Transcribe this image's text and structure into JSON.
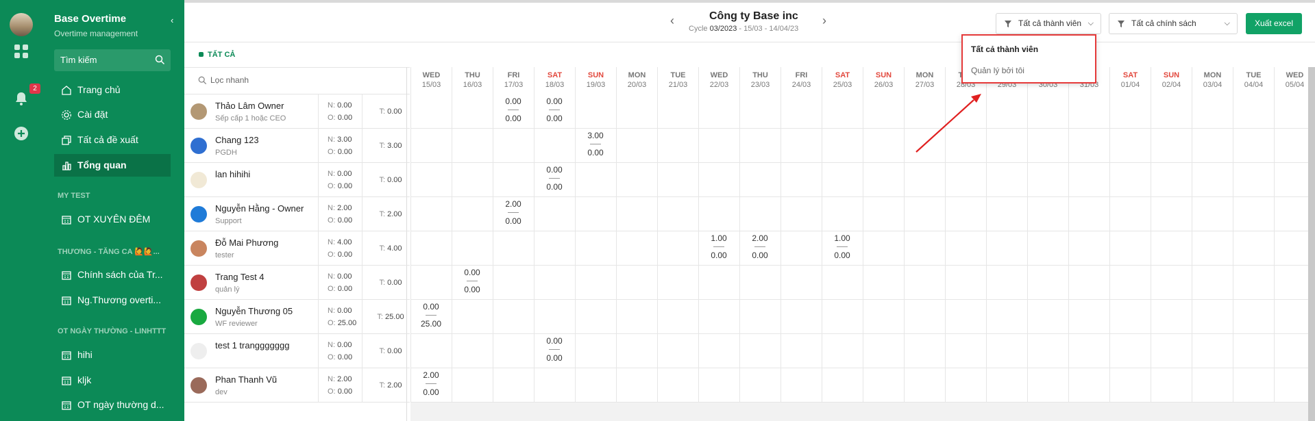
{
  "app": {
    "title": "Base Overtime",
    "subtitle": "Overtime management",
    "notif_count": "2"
  },
  "sidebar": {
    "search_label": "Tìm kiếm",
    "items": [
      {
        "label": "Trang chủ",
        "icon": "home-icon"
      },
      {
        "label": "Cài đặt",
        "icon": "gear-icon"
      },
      {
        "label": "Tất cả đề xuất",
        "icon": "copy-icon"
      },
      {
        "label": "Tổng quan",
        "icon": "chart-icon"
      }
    ],
    "groups": [
      {
        "title": "MY TEST",
        "items": [
          "OT XUYÊN ĐÊM"
        ]
      },
      {
        "title": "THƯƠNG - TĂNG CA 🙋🙋...",
        "items": [
          "Chính sách của Tr...",
          "Ng.Thương overti..."
        ]
      },
      {
        "title": "OT NGÀY THƯỜNG - LINHTTT",
        "items": [
          "hihi",
          "kljk",
          "OT ngày thường d..."
        ]
      }
    ]
  },
  "header": {
    "company": "Công ty Base inc",
    "cycle_prefix": "Cycle",
    "cycle_value": "03/2023",
    "cycle_range": "- 15/03 - 14/04/23",
    "filter_members": "Tất cả thành viên",
    "filter_policies": "Tất cả chính sách",
    "export_label": "Xuất excel"
  },
  "dropdown": {
    "options": [
      "Tất cả thành viên",
      "Quản lý bởi tôi"
    ]
  },
  "tab_all": "TẤT CẢ",
  "quick_search_placeholder": "Lọc nhanh",
  "days": [
    {
      "dn": "WED",
      "d": "15/03"
    },
    {
      "dn": "THU",
      "d": "16/03"
    },
    {
      "dn": "FRI",
      "d": "17/03"
    },
    {
      "dn": "SAT",
      "d": "18/03",
      "we": true
    },
    {
      "dn": "SUN",
      "d": "19/03",
      "we": true
    },
    {
      "dn": "MON",
      "d": "20/03"
    },
    {
      "dn": "TUE",
      "d": "21/03"
    },
    {
      "dn": "WED",
      "d": "22/03"
    },
    {
      "dn": "THU",
      "d": "23/03"
    },
    {
      "dn": "FRI",
      "d": "24/03"
    },
    {
      "dn": "SAT",
      "d": "25/03",
      "we": true
    },
    {
      "dn": "SUN",
      "d": "26/03",
      "we": true
    },
    {
      "dn": "MON",
      "d": "27/03"
    },
    {
      "dn": "TUE",
      "d": "28/03"
    },
    {
      "dn": "WED",
      "d": "29/03"
    },
    {
      "dn": "THU",
      "d": "30/03"
    },
    {
      "dn": "FRI",
      "d": "31/03"
    },
    {
      "dn": "SAT",
      "d": "01/04",
      "we": true
    },
    {
      "dn": "SUN",
      "d": "02/04",
      "we": true
    },
    {
      "dn": "MON",
      "d": "03/04"
    },
    {
      "dn": "TUE",
      "d": "04/04"
    },
    {
      "dn": "WED",
      "d": "05/04"
    }
  ],
  "members": [
    {
      "name": "Thảo Lâm Owner",
      "role": "Sếp cấp 1 hoặc CEO",
      "n": "0.00",
      "o": "0.00",
      "t": "0.00",
      "avatar": "#b39874",
      "cells": [
        {
          "day": 2,
          "a": "0.00",
          "b": "0.00"
        },
        {
          "day": 3,
          "a": "0.00",
          "b": "0.00"
        }
      ]
    },
    {
      "name": "Chang 123",
      "role": "PGDH",
      "n": "3.00",
      "o": "0.00",
      "t": "3.00",
      "avatar": "#2f6fd1",
      "cells": [
        {
          "day": 4,
          "a": "3.00",
          "b": "0.00"
        }
      ]
    },
    {
      "name": "lan hihihi",
      "role": "",
      "n": "0.00",
      "o": "0.00",
      "t": "0.00",
      "avatar": "#f1e9d6",
      "cells": [
        {
          "day": 3,
          "a": "0.00",
          "b": "0.00"
        }
      ]
    },
    {
      "name": "Nguyễn Hằng - Owner",
      "role": "Support",
      "n": "2.00",
      "o": "0.00",
      "t": "2.00",
      "avatar": "#1f7bd8",
      "cells": [
        {
          "day": 2,
          "a": "2.00",
          "b": "0.00"
        }
      ]
    },
    {
      "name": "Đỗ Mai Phương",
      "role": "tester",
      "n": "4.00",
      "o": "0.00",
      "t": "4.00",
      "avatar": "#c9855f",
      "cells": [
        {
          "day": 7,
          "a": "1.00",
          "b": "0.00"
        },
        {
          "day": 8,
          "a": "2.00",
          "b": "0.00"
        },
        {
          "day": 10,
          "a": "1.00",
          "b": "0.00"
        }
      ]
    },
    {
      "name": "Trang Test 4",
      "role": "quản lý",
      "n": "0.00",
      "o": "0.00",
      "t": "0.00",
      "avatar": "#c04040",
      "cells": [
        {
          "day": 1,
          "a": "0.00",
          "b": "0.00"
        }
      ]
    },
    {
      "name": "Nguyễn Thương 05",
      "role": "WF reviewer",
      "n": "0.00",
      "o": "25.00",
      "t": "25.00",
      "avatar": "#19a940",
      "cells": [
        {
          "day": 0,
          "a": "0.00",
          "b": "25.00"
        }
      ]
    },
    {
      "name": "test 1 tranggggggg",
      "role": "",
      "n": "0.00",
      "o": "0.00",
      "t": "0.00",
      "avatar": "#eeeeee",
      "cells": [
        {
          "day": 3,
          "a": "0.00",
          "b": "0.00"
        }
      ]
    },
    {
      "name": "Phan Thanh Vũ",
      "role": "dev",
      "n": "2.00",
      "o": "0.00",
      "t": "2.00",
      "avatar": "#9a6a5a",
      "cells": [
        {
          "day": 0,
          "a": "2.00",
          "b": "0.00"
        }
      ]
    }
  ],
  "labels": {
    "n": "N:",
    "o": "O:",
    "t": "T:"
  }
}
